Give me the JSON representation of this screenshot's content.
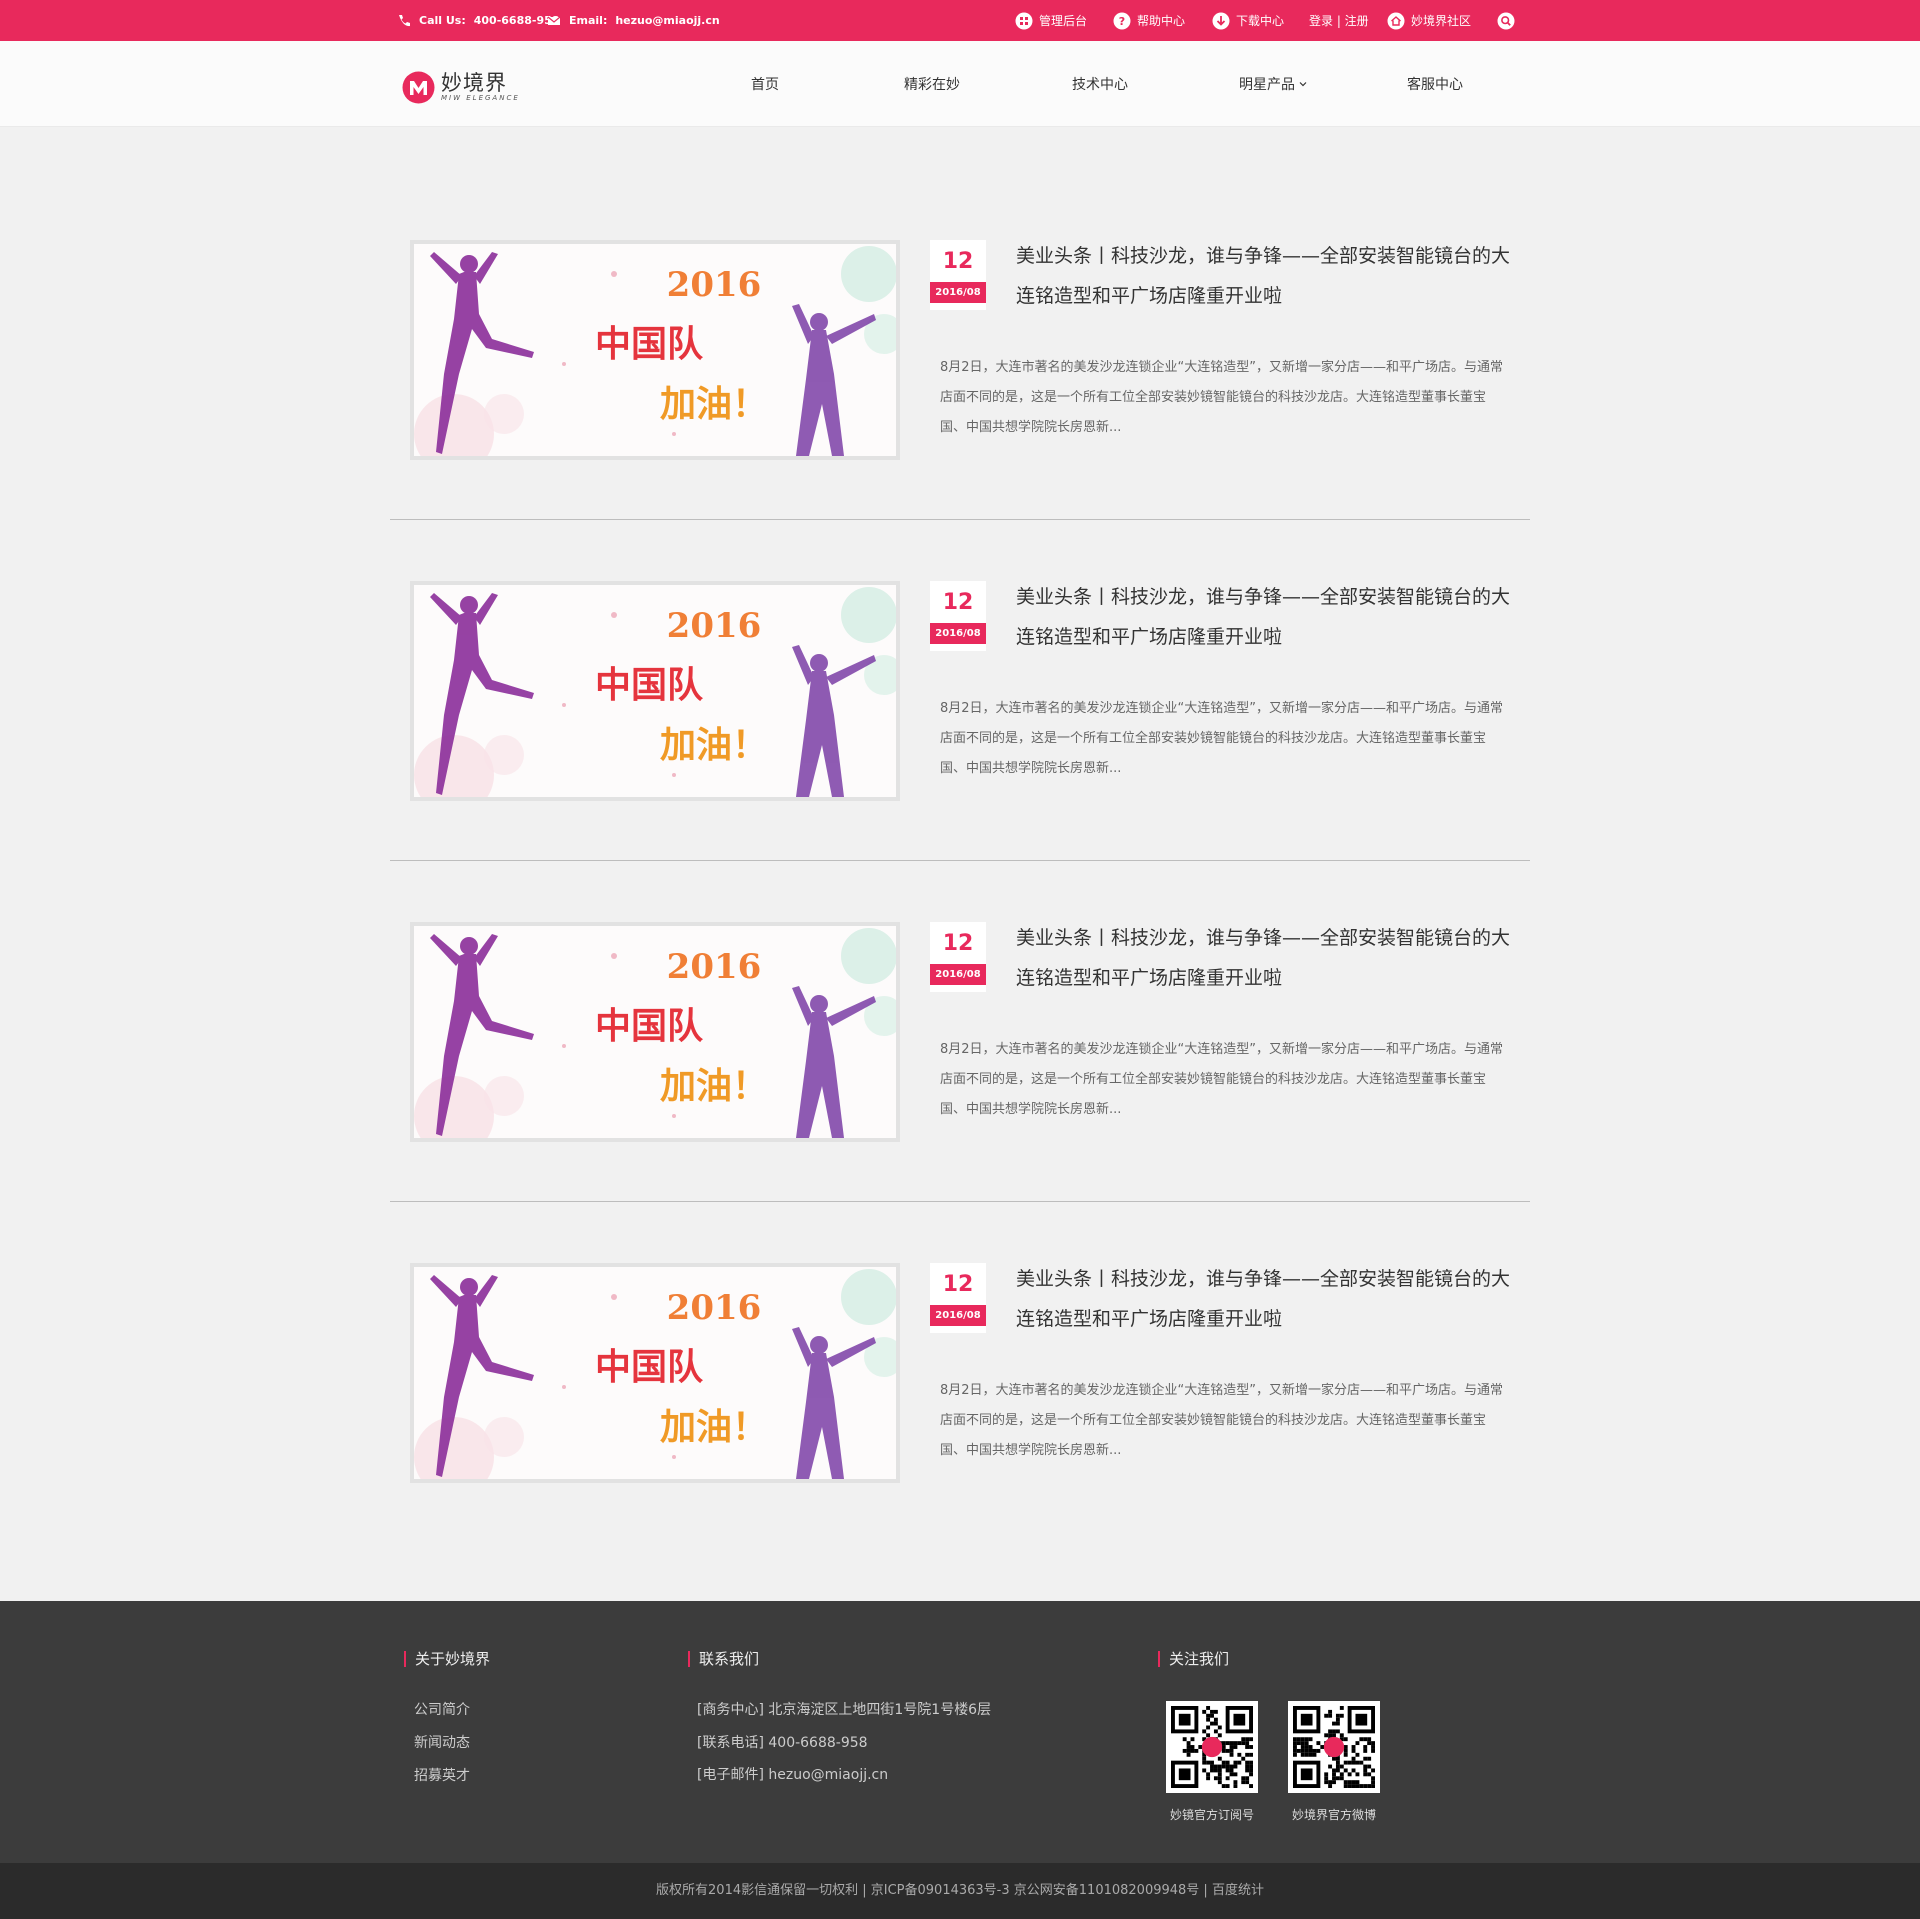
{
  "topbar": {
    "call_label": "Call Us:",
    "phone": "400-6688-958",
    "email_label": "Email:",
    "email": "hezuo@miaojj.cn",
    "links": [
      {
        "label": "管理后台",
        "icon": "grid-icon"
      },
      {
        "label": "帮助中心",
        "icon": "help-icon"
      },
      {
        "label": "下载中心",
        "icon": "download-icon"
      },
      {
        "label": "登录 | 注册",
        "icon": ""
      },
      {
        "label": "妙境界社区",
        "icon": "home-icon"
      }
    ],
    "search_icon": "search-icon",
    "color": "#e8295c"
  },
  "header": {
    "logo_cn": "妙境界",
    "logo_en": "MIW ELEGANCE",
    "nav": [
      "首页",
      "精彩在妙",
      "技术中心",
      "明星产品",
      "客服中心"
    ]
  },
  "articles": [
    {
      "day": "12",
      "ym": "2016/08",
      "title": "美业头条丨科技沙龙，谁与争锋——全部安装智能镜台的大连铭造型和平广场店隆重开业啦",
      "desc": "8月2日，大连市著名的美发沙龙连锁企业“大连铭造型”，又新增一家分店——和平广场店。与通常店面不同的是，这是一个所有工位全部安装妙镜智能镜台的科技沙龙店。大连铭造型董事长董宝国、中国共想学院院长房恩新...",
      "image_text": {
        "year": "2016",
        "line1": "中国队",
        "line2": "加油！"
      }
    },
    {
      "day": "12",
      "ym": "2016/08",
      "title": "美业头条丨科技沙龙，谁与争锋——全部安装智能镜台的大连铭造型和平广场店隆重开业啦",
      "desc": "8月2日，大连市著名的美发沙龙连锁企业“大连铭造型”，又新增一家分店——和平广场店。与通常店面不同的是，这是一个所有工位全部安装妙镜智能镜台的科技沙龙店。大连铭造型董事长董宝国、中国共想学院院长房恩新...",
      "image_text": {
        "year": "2016",
        "line1": "中国队",
        "line2": "加油！"
      }
    },
    {
      "day": "12",
      "ym": "2016/08",
      "title": "美业头条丨科技沙龙，谁与争锋——全部安装智能镜台的大连铭造型和平广场店隆重开业啦",
      "desc": "8月2日，大连市著名的美发沙龙连锁企业“大连铭造型”，又新增一家分店——和平广场店。与通常店面不同的是，这是一个所有工位全部安装妙镜智能镜台的科技沙龙店。大连铭造型董事长董宝国、中国共想学院院长房恩新...",
      "image_text": {
        "year": "2016",
        "line1": "中国队",
        "line2": "加油！"
      }
    },
    {
      "day": "12",
      "ym": "2016/08",
      "title": "美业头条丨科技沙龙，谁与争锋——全部安装智能镜台的大连铭造型和平广场店隆重开业啦",
      "desc": "8月2日，大连市著名的美发沙龙连锁企业“大连铭造型”，又新增一家分店——和平广场店。与通常店面不同的是，这是一个所有工位全部安装妙镜智能镜台的科技沙龙店。大连铭造型董事长董宝国、中国共想学院院长房恩新...",
      "image_text": {
        "year": "2016",
        "line1": "中国队",
        "line2": "加油！"
      }
    }
  ],
  "footer": {
    "about": {
      "title": "关于妙境界",
      "links": [
        "公司简介",
        "新闻动态",
        "招募英才"
      ]
    },
    "contact": {
      "title": "联系我们",
      "lines": [
        "[商务中心] 北京海淀区上地四街1号院1号楼6层",
        "[联系电话] 400-6688-958",
        "[电子邮件] hezuo@miaojj.cn"
      ]
    },
    "follow": {
      "title": "关注我们",
      "qr_captions": [
        "妙镜官方订阅号",
        "妙境界官方微博"
      ]
    },
    "copyright": "版权所有2014影信通保留一切权利 | 京ICP备09014363号-3 京公网安备1101082009948号 | 百度统计"
  }
}
